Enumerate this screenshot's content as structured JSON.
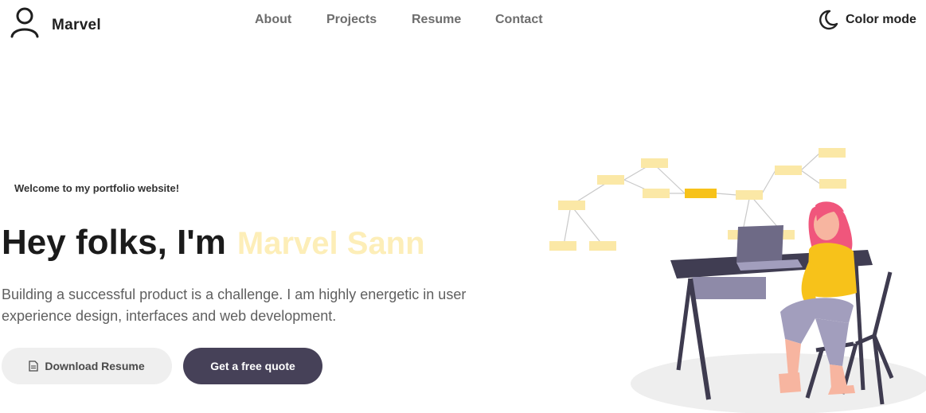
{
  "header": {
    "brand": "Marvel",
    "nav": [
      "About",
      "Projects",
      "Resume",
      "Contact"
    ],
    "color_mode_label": "Color mode"
  },
  "hero": {
    "welcome": "Welcome to my portfolio website!",
    "greeting": "Hey folks, I'm",
    "name": "Marvel Sann",
    "description": "Building a successful product is a challenge. I am highly energetic in user experience design, interfaces and web development.",
    "download_button": "Download Resume",
    "quote_button": "Get a free quote"
  },
  "colors": {
    "accent_yellow": "#fdeeb8",
    "highlight_yellow": "#f7c21a",
    "dark_button": "#464158"
  }
}
